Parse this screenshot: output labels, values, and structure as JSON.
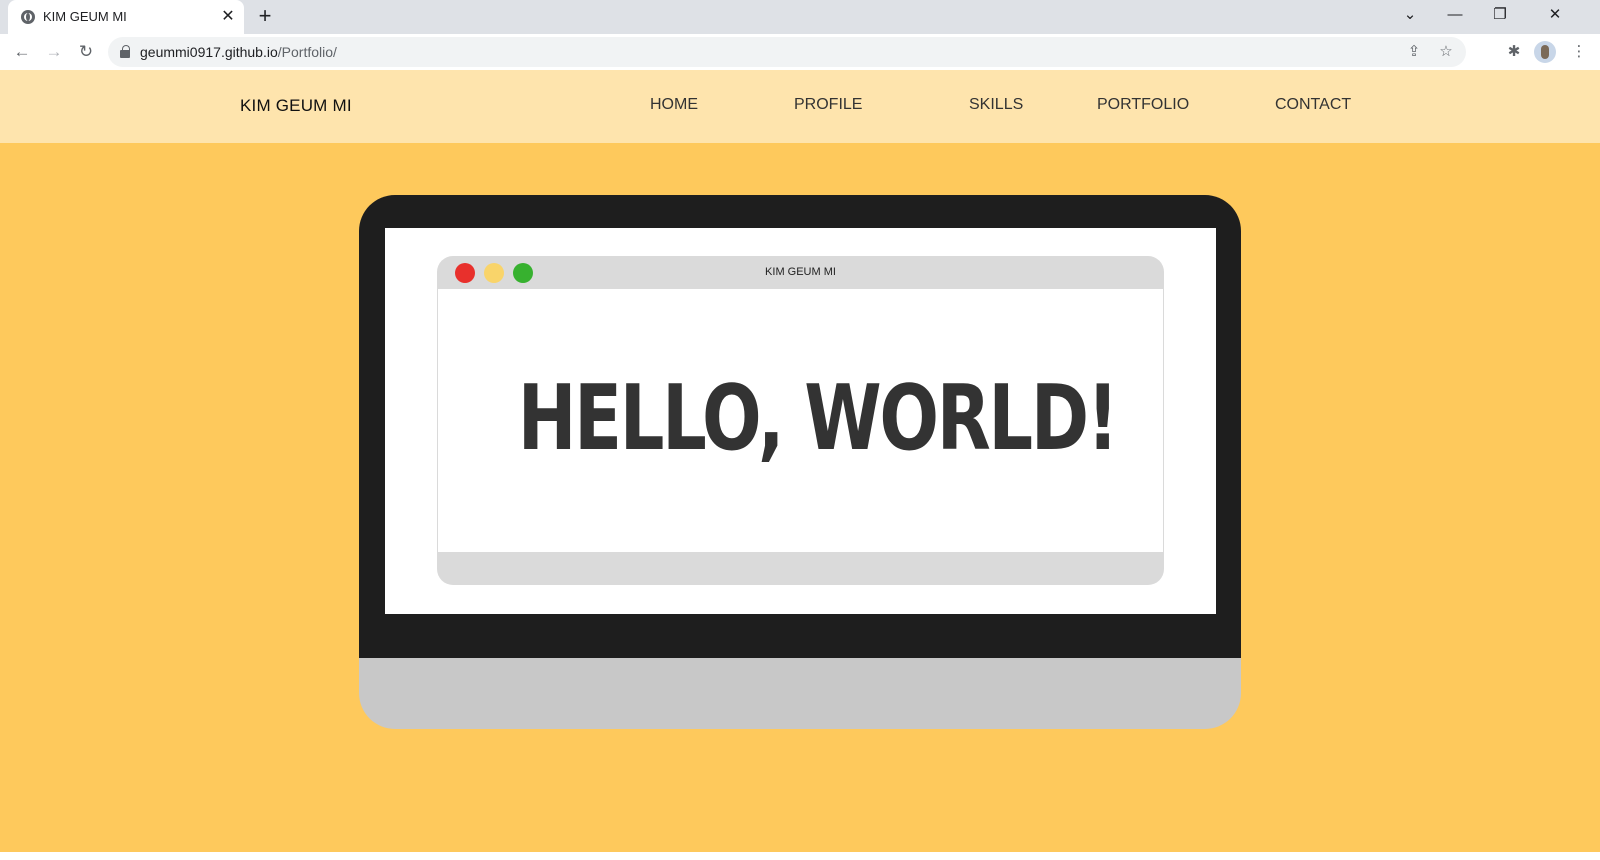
{
  "browser": {
    "tab": {
      "title": "KIM GEUM MI",
      "close_glyph": "✕"
    },
    "new_tab_glyph": "+",
    "window_controls": {
      "dropdown": "⌄",
      "minimize": "—",
      "restore": "❐",
      "close": "✕"
    },
    "nav": {
      "back": "←",
      "forward": "→",
      "reload": "↻"
    },
    "address": {
      "host": "geummi0917.github.io",
      "path": "/Portfolio/"
    },
    "icons": {
      "share": "⇪",
      "bookmark": "☆",
      "extensions": "✱",
      "menu": "⋮"
    }
  },
  "site": {
    "brand": "KIM GEUM MI",
    "nav": [
      "HOME",
      "PROFILE",
      "SKILLS",
      "PORTFOLIO",
      "CONTACT"
    ],
    "colors": {
      "nav_bg": "#fee4ad",
      "hero_bg": "#fec95c",
      "monitor": "#1e1e1e",
      "stand": "#c8c8c8"
    }
  },
  "hero": {
    "window_title": "KIM GEUM MI",
    "headline": "HELLO, WORLD!"
  }
}
